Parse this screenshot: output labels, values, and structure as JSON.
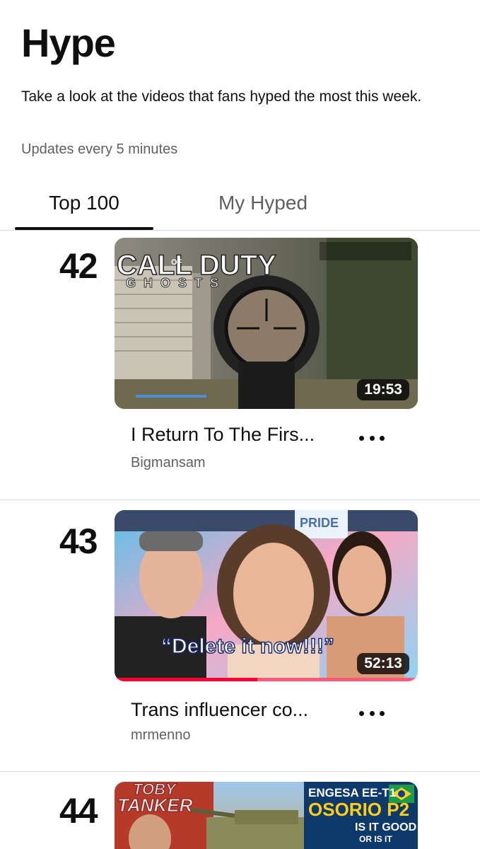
{
  "header": {
    "title": "Hype",
    "description": "Take a look at the videos that fans hyped the most this week.",
    "updates": "Updates every 5 minutes"
  },
  "tabs": [
    {
      "label": "Top 100",
      "active": true
    },
    {
      "label": "My Hyped",
      "active": false
    }
  ],
  "videos": [
    {
      "rank": "42",
      "title": "I Return To The Firs...",
      "channel": "Bigmansam",
      "duration": "19:53",
      "thumb_text": {
        "logo_main": "CALL DUTY",
        "logo_of": "OF",
        "logo_sub": "GHOSTS"
      }
    },
    {
      "rank": "43",
      "title": "Trans influencer co...",
      "channel": "mrmenno",
      "duration": "52:13",
      "watched_fraction": 0.47,
      "thumb_text": {
        "caption": "“Delete it now!!!”",
        "sign": "PRIDE"
      }
    },
    {
      "rank": "44",
      "thumb_text": {
        "logo_main": "TOBY",
        "logo_sub": "TANKER",
        "tag_line1": "ENGESA EE-T1",
        "tag_line2": "OSORIO P2",
        "tag_line3": "IS IT GOOD",
        "tag_line4": "OR IS IT"
      }
    }
  ],
  "colors": {
    "accent": "#ff0033",
    "text_primary": "#0f0f0f",
    "text_secondary": "#606060",
    "divider": "#d9d9d9"
  },
  "icons": {
    "more": "more-horizontal-icon"
  }
}
